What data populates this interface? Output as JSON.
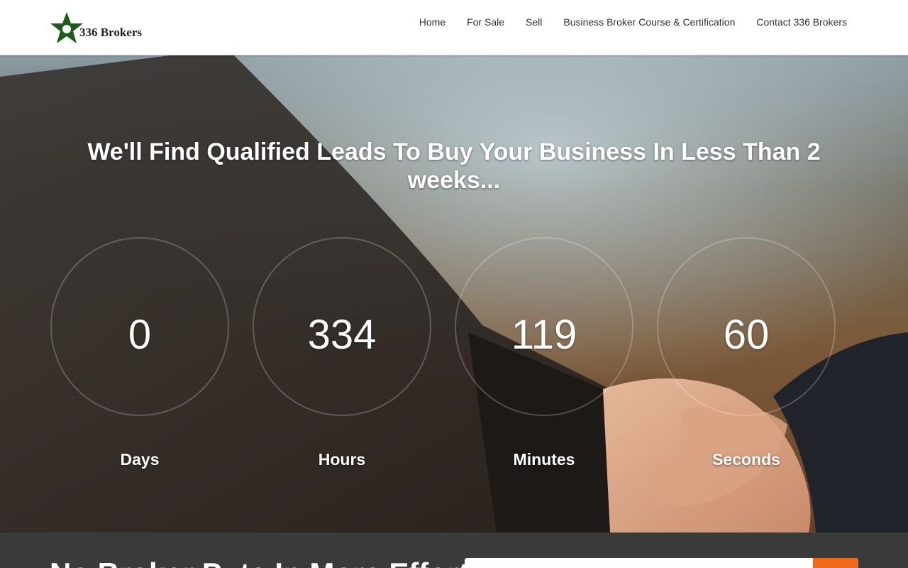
{
  "header": {
    "logo_text": "336 Brokers",
    "nav": [
      "Home",
      "For Sale",
      "Sell",
      "Business Broker Course & Certification",
      "Contact 336 Brokers"
    ]
  },
  "hero": {
    "title": "We'll Find Qualified Leads To Buy Your Business In Less Than 2 weeks...",
    "timer": [
      {
        "value": "0",
        "label": "Days"
      },
      {
        "value": "334",
        "label": "Hours"
      },
      {
        "value": "119",
        "label": "Minutes"
      },
      {
        "value": "60",
        "label": "Seconds"
      }
    ]
  },
  "cta": {
    "heading": "No Broker Puts In More Effort!",
    "input_placeholder": "",
    "button_label": ""
  },
  "colors": {
    "logo_green": "#1e5a1a",
    "cta_background": "#3a3a3a",
    "cta_button": "#f06a1a"
  }
}
